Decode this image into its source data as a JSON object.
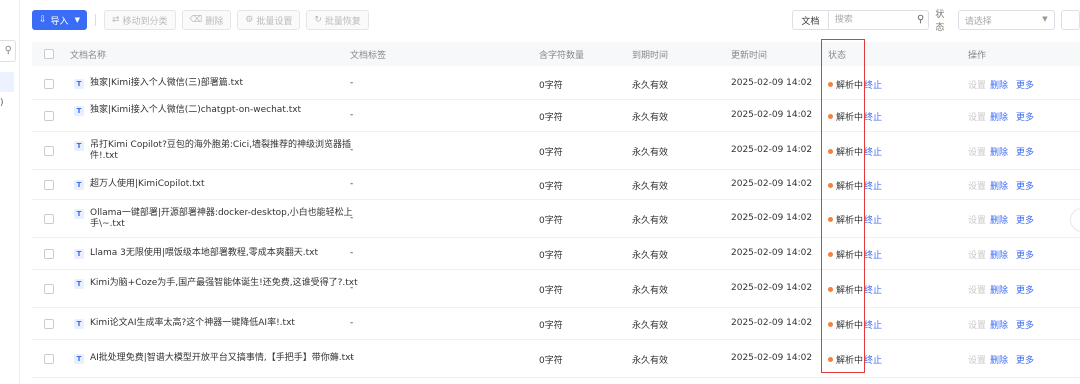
{
  "sidebar": {
    "item_text": ")"
  },
  "toolbar": {
    "import_label": "导入",
    "move_label": "移动到分类",
    "delete_label": "删除",
    "batch_settings_label": "批量设置",
    "batch_restore_label": "批量恢复"
  },
  "filters": {
    "type_value": "文档",
    "search_placeholder": "搜索",
    "status_label": "状态",
    "status_placeholder": "请选择"
  },
  "table": {
    "headers": {
      "name": "文档名称",
      "tags": "文档标签",
      "chars": "含字符数量",
      "expire": "到期时间",
      "updated": "更新时间",
      "status": "状态",
      "actions": "操作"
    },
    "rows": [
      {
        "icon": "T",
        "name": "独家|Kimi接入个人微信(三)部署篇.txt",
        "tags": "-",
        "chars": "0字符",
        "expire": "永久有效",
        "updated": "2025-02-09 14:02",
        "status": "解析中",
        "stop": "终止",
        "set": "设置",
        "delete": "删除",
        "more": "更多"
      },
      {
        "icon": "T",
        "name": "独家|Kimi接入个人微信(二)chatgpt-on-wechat.txt",
        "tags": "-",
        "chars": "0字符",
        "expire": "永久有效",
        "updated": "2025-02-09 14:02",
        "status": "解析中",
        "stop": "终止",
        "set": "设置",
        "delete": "删除",
        "more": "更多"
      },
      {
        "icon": "T",
        "name": "吊打Kimi Copilot?豆包的海外胞弟:Cici,墙裂推荐的神级浏览器插件!.txt",
        "tags": "-",
        "chars": "0字符",
        "expire": "永久有效",
        "updated": "2025-02-09 14:02",
        "status": "解析中",
        "stop": "终止",
        "set": "设置",
        "delete": "删除",
        "more": "更多"
      },
      {
        "icon": "T",
        "name": "超万人使用|KimiCopilot.txt",
        "tags": "-",
        "chars": "0字符",
        "expire": "永久有效",
        "updated": "2025-02-09 14:02",
        "status": "解析中",
        "stop": "终止",
        "set": "设置",
        "delete": "删除",
        "more": "更多"
      },
      {
        "icon": "T",
        "name": "Ollama一键部署|开源部署神器:docker-desktop,小白也能轻松上手\\~.txt",
        "tags": "-",
        "chars": "0字符",
        "expire": "永久有效",
        "updated": "2025-02-09 14:02",
        "status": "解析中",
        "stop": "终止",
        "set": "设置",
        "delete": "删除",
        "more": "更多"
      },
      {
        "icon": "T",
        "name": "Llama 3无限使用|喂饭级本地部署教程,零成本爽翻天.txt",
        "tags": "-",
        "chars": "0字符",
        "expire": "永久有效",
        "updated": "2025-02-09 14:02",
        "status": "解析中",
        "stop": "终止",
        "set": "设置",
        "delete": "删除",
        "more": "更多"
      },
      {
        "icon": "T",
        "name": "Kimi为脑+Coze为手,国产最强智能体诞生!还免费,这谁受得了?.txt",
        "tags": "-",
        "chars": "0字符",
        "expire": "永久有效",
        "updated": "2025-02-09 14:02",
        "status": "解析中",
        "stop": "终止",
        "set": "设置",
        "delete": "删除",
        "more": "更多"
      },
      {
        "icon": "T",
        "name": "Kimi论文AI生成率太高?这个神器一键降低AI率!.txt",
        "tags": "-",
        "chars": "0字符",
        "expire": "永久有效",
        "updated": "2025-02-09 14:02",
        "status": "解析中",
        "stop": "终止",
        "set": "设置",
        "delete": "删除",
        "more": "更多"
      },
      {
        "icon": "T",
        "name": "AI批处理免费|智谱大模型开放平台又搞事情,【手把手】带你薅.txt",
        "tags": "-",
        "chars": "0字符",
        "expire": "永久有效",
        "updated": "2025-02-09 14:02",
        "status": "解析中",
        "stop": "终止",
        "set": "设置",
        "delete": "删除",
        "more": "更多"
      }
    ]
  },
  "colors": {
    "accent": "#3b6cf5",
    "status_dot": "#f5813a",
    "highlight_border": "#e03a3a"
  }
}
